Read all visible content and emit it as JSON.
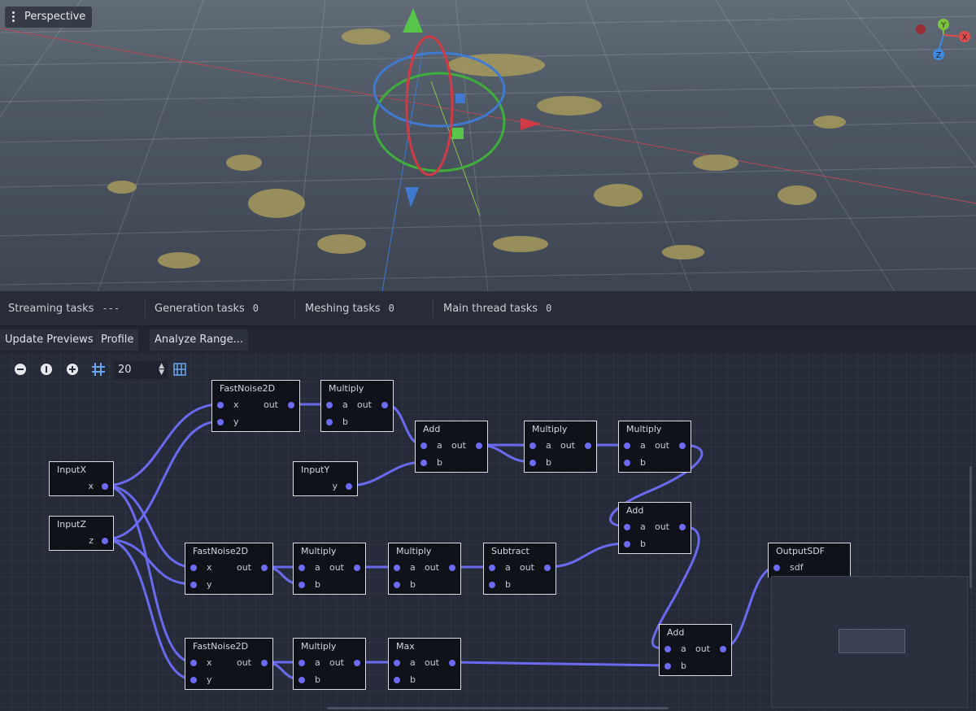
{
  "viewport": {
    "camera_label": "Perspective"
  },
  "gizmo_axes": {
    "x": "X",
    "y": "Y",
    "z": "Z"
  },
  "status": [
    {
      "label": "Streaming tasks",
      "value": "---"
    },
    {
      "label": "Generation tasks",
      "value": "0"
    },
    {
      "label": "Meshing tasks",
      "value": "0"
    },
    {
      "label": "Main thread tasks",
      "value": "0"
    }
  ],
  "toolbar": {
    "update": "Update Previews",
    "profile": "Profile",
    "analyze": "Analyze Range..."
  },
  "graph_toolbar": {
    "zoom_value": "20"
  },
  "nodes": {
    "inputx": {
      "title": "InputX",
      "out": "x"
    },
    "inputz": {
      "title": "InputZ",
      "out": "z"
    },
    "inputy": {
      "title": "InputY",
      "out": "y"
    },
    "noise1": {
      "title": "FastNoise2D",
      "in1": "x",
      "in2": "y",
      "out": "out"
    },
    "noise2": {
      "title": "FastNoise2D",
      "in1": "x",
      "in2": "y",
      "out": "out"
    },
    "noise3": {
      "title": "FastNoise2D",
      "in1": "x",
      "in2": "y",
      "out": "out"
    },
    "mul1": {
      "title": "Multiply",
      "in1": "a",
      "in2": "b",
      "out": "out"
    },
    "add1": {
      "title": "Add",
      "in1": "a",
      "in2": "b",
      "out": "out"
    },
    "mul2": {
      "title": "Multiply",
      "in1": "a",
      "in2": "b",
      "out": "out"
    },
    "mul3": {
      "title": "Multiply",
      "in1": "a",
      "in2": "b",
      "out": "out"
    },
    "add2": {
      "title": "Add",
      "in1": "a",
      "in2": "b",
      "out": "out"
    },
    "mul4": {
      "title": "Multiply",
      "in1": "a",
      "in2": "b",
      "out": "out"
    },
    "mul5": {
      "title": "Multiply",
      "in1": "a",
      "in2": "b",
      "out": "out"
    },
    "sub1": {
      "title": "Subtract",
      "in1": "a",
      "in2": "b",
      "out": "out"
    },
    "mul6": {
      "title": "Multiply",
      "in1": "a",
      "in2": "b",
      "out": "out"
    },
    "max1": {
      "title": "Max",
      "in1": "a",
      "in2": "b",
      "out": "out"
    },
    "add3": {
      "title": "Add",
      "in1": "a",
      "in2": "b",
      "out": "out"
    },
    "output": {
      "title": "OutputSDF",
      "in1": "sdf"
    }
  }
}
